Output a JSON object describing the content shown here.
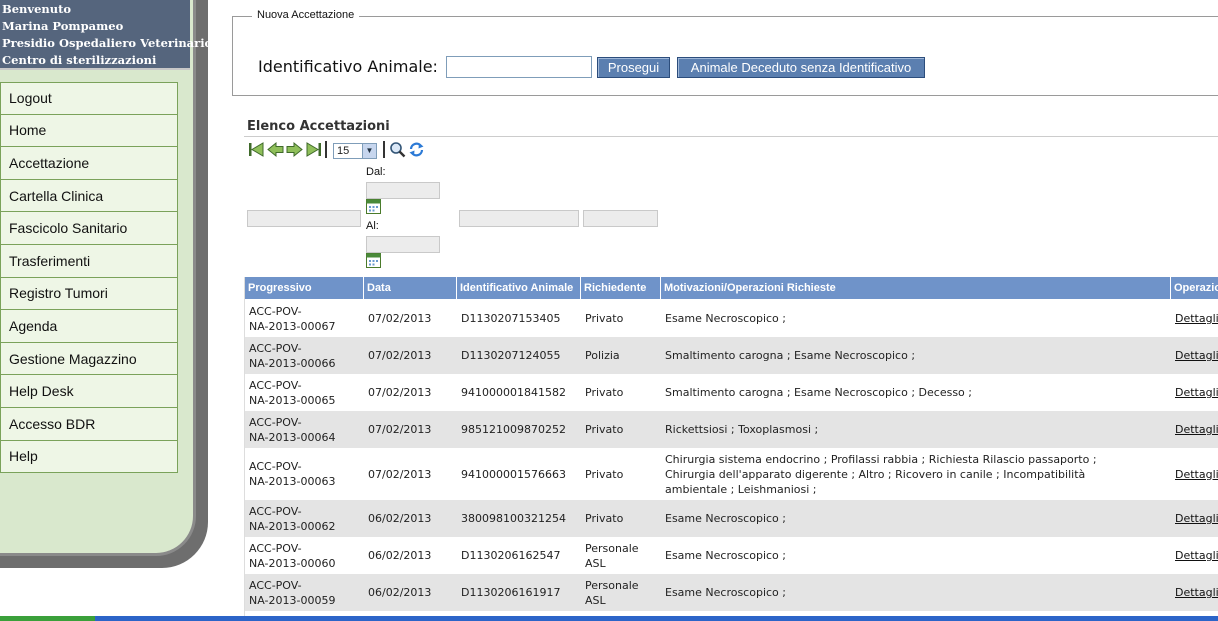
{
  "user": {
    "greeting": "Benvenuto",
    "name": "Marina Pompameo",
    "facility": "Presidio Ospedaliero Veterinario",
    "department": "Centro di sterilizzazioni"
  },
  "menu": {
    "items": [
      {
        "label": "Logout"
      },
      {
        "label": "Home"
      },
      {
        "label": "Accettazione"
      },
      {
        "label": "Cartella Clinica"
      },
      {
        "label": "Fascicolo Sanitario"
      },
      {
        "label": "Trasferimenti"
      },
      {
        "label": "Registro Tumori"
      },
      {
        "label": "Agenda"
      },
      {
        "label": "Gestione Magazzino"
      },
      {
        "label": "Help Desk"
      },
      {
        "label": "Accesso BDR"
      },
      {
        "label": "Help"
      }
    ]
  },
  "form": {
    "legend": "Nuova Accettazione",
    "id_label": "Identificativo Animale:",
    "id_value": "",
    "prosegui_label": "Prosegui",
    "deceduto_label": "Animale Deceduto senza Identificativo"
  },
  "list": {
    "title": "Elenco Accettazioni",
    "page_size": "15",
    "filter_dal_label": "Dal:",
    "filter_al_label": "Al:",
    "columns": [
      "Progressivo",
      "Data",
      "Identificativo Animale",
      "Richiedente",
      "Motivazioni/Operazioni Richieste",
      "Operazioni"
    ],
    "rows": [
      {
        "progressivo": "ACC-POV-\nNA-2013-00067",
        "data": "07/02/2013",
        "id": "D1130207153405",
        "richiedente": "Privato",
        "motivazioni": "Esame Necroscopico ;",
        "op": "Dettaglio"
      },
      {
        "progressivo": "ACC-POV-\nNA-2013-00066",
        "data": "07/02/2013",
        "id": "D1130207124055",
        "richiedente": "Polizia",
        "motivazioni": "Smaltimento carogna ; Esame Necroscopico ;",
        "op": "Dettaglio"
      },
      {
        "progressivo": "ACC-POV-\nNA-2013-00065",
        "data": "07/02/2013",
        "id": "941000001841582",
        "richiedente": "Privato",
        "motivazioni": "Smaltimento carogna ; Esame Necroscopico ; Decesso ;",
        "op": "Dettaglio"
      },
      {
        "progressivo": "ACC-POV-\nNA-2013-00064",
        "data": "07/02/2013",
        "id": "985121009870252",
        "richiedente": "Privato",
        "motivazioni": "Rickettsiosi ; Toxoplasmosi ;",
        "op": "Dettaglio"
      },
      {
        "progressivo": "ACC-POV-\nNA-2013-00063",
        "data": "07/02/2013",
        "id": "941000001576663",
        "richiedente": "Privato",
        "motivazioni": "Chirurgia sistema endocrino ; Profilassi rabbia ; Richiesta Rilascio passaporto ;\nChirurgia dell'apparato digerente ; Altro ; Ricovero in canile ; Incompatibilità\nambientale ; Leishmaniosi ;",
        "op": "Dettaglio"
      },
      {
        "progressivo": "ACC-POV-\nNA-2013-00062",
        "data": "06/02/2013",
        "id": "380098100321254",
        "richiedente": "Privato",
        "motivazioni": "Esame Necroscopico ;",
        "op": "Dettaglio"
      },
      {
        "progressivo": "ACC-POV-\nNA-2013-00060",
        "data": "06/02/2013",
        "id": "D1130206162547",
        "richiedente": "Personale\nASL",
        "motivazioni": "Esame Necroscopico ;",
        "op": "Dettaglio"
      },
      {
        "progressivo": "ACC-POV-\nNA-2013-00059",
        "data": "06/02/2013",
        "id": "D1130206161917",
        "richiedente": "Personale\nASL",
        "motivazioni": "Esame Necroscopico ;",
        "op": "Dettaglio"
      }
    ]
  },
  "icons": {
    "first": "first-page-icon",
    "prev": "prev-page-icon",
    "next": "next-page-icon",
    "last": "last-page-icon",
    "search": "search-icon",
    "refresh": "refresh-icon",
    "calendar": "calendar-icon"
  },
  "colors": {
    "sidebar_bg": "#d9e8cd",
    "user_box": "#55657d",
    "button": "#5b7fb0",
    "table_header": "#6f93c9"
  }
}
